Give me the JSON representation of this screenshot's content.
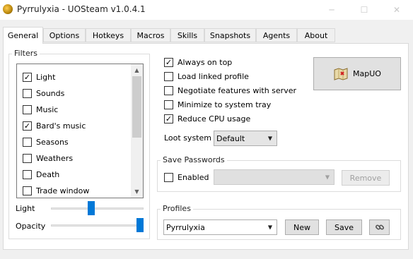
{
  "window": {
    "title": "Pyrrulyxia - UOSteam v1.0.4.1"
  },
  "tabs": [
    "General",
    "Options",
    "Hotkeys",
    "Macros",
    "Skills",
    "Snapshots",
    "Agents",
    "About"
  ],
  "filters": {
    "title": "Filters",
    "items": [
      {
        "label": "Light",
        "checked": true
      },
      {
        "label": "Sounds",
        "checked": false
      },
      {
        "label": "Music",
        "checked": false
      },
      {
        "label": "Bard's music",
        "checked": true
      },
      {
        "label": "Seasons",
        "checked": false
      },
      {
        "label": "Weathers",
        "checked": false
      },
      {
        "label": "Death",
        "checked": false
      },
      {
        "label": "Trade window",
        "checked": false
      }
    ],
    "light_label": "Light",
    "light_level": 0.43,
    "opacity_label": "Opacity",
    "opacity_level": 1.0
  },
  "options": [
    {
      "label": "Always on top",
      "checked": true
    },
    {
      "label": "Load linked profile",
      "checked": false
    },
    {
      "label": "Negotiate features with server",
      "checked": false
    },
    {
      "label": "Minimize to system tray",
      "checked": false
    },
    {
      "label": "Reduce CPU usage",
      "checked": true
    }
  ],
  "loot": {
    "label": "Loot system",
    "value": "Default"
  },
  "mapuo": {
    "label": "MapUO"
  },
  "save_passwords": {
    "title": "Save Passwords",
    "enabled_label": "Enabled",
    "enabled": false,
    "remove_label": "Remove"
  },
  "profiles": {
    "title": "Profiles",
    "selected": "Pyrrulyxia",
    "new_label": "New",
    "save_label": "Save"
  },
  "icons": {
    "check": "✓",
    "down": "▼",
    "up": "▲",
    "minimize": "─",
    "maximize": "☐",
    "close": "✕"
  }
}
